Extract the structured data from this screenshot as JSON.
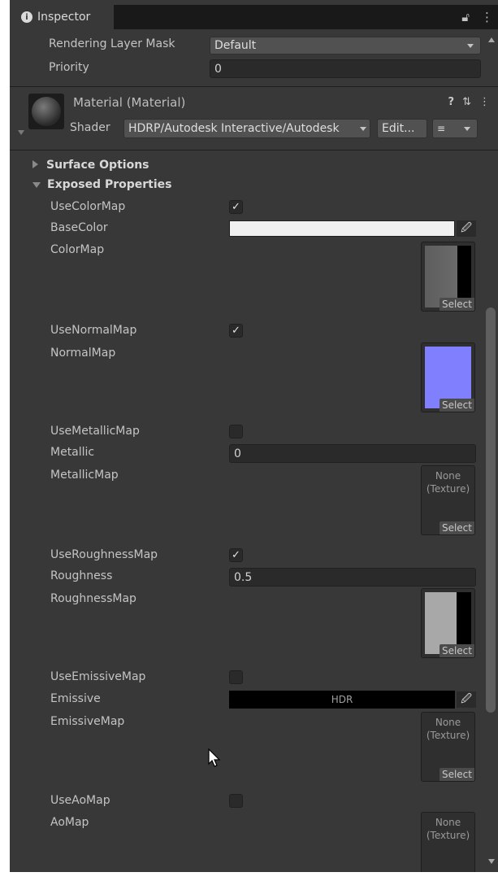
{
  "tab": {
    "title": "Inspector"
  },
  "rendering": {
    "layer_mask_label": "Rendering Layer Mask",
    "layer_mask_value": "Default",
    "priority_label": "Priority",
    "priority_value": "0"
  },
  "material": {
    "title": "Material (Material)",
    "shader_label": "Shader",
    "shader_value": "HDRP/Autodesk Interactive/Autodesk",
    "edit_label": "Edit...",
    "help_icon": "?"
  },
  "sections": {
    "surface_options": "Surface Options",
    "exposed_properties": "Exposed Properties"
  },
  "properties": {
    "use_color_map": {
      "label": "UseColorMap",
      "checked": true
    },
    "base_color": {
      "label": "BaseColor",
      "color": "#f0f0f0"
    },
    "color_map": {
      "label": "ColorMap",
      "select": "Select"
    },
    "use_normal_map": {
      "label": "UseNormalMap",
      "checked": true
    },
    "normal_map": {
      "label": "NormalMap",
      "select": "Select",
      "color": "#8080ff"
    },
    "use_metallic_map": {
      "label": "UseMetallicMap",
      "checked": false
    },
    "metallic": {
      "label": "Metallic",
      "value": "0"
    },
    "metallic_map": {
      "label": "MetallicMap",
      "none": "None",
      "none2": "(Texture)",
      "select": "Select"
    },
    "use_roughness_map": {
      "label": "UseRoughnessMap",
      "checked": true
    },
    "roughness": {
      "label": "Roughness",
      "value": "0.5"
    },
    "roughness_map": {
      "label": "RoughnessMap",
      "select": "Select"
    },
    "use_emissive_map": {
      "label": "UseEmissiveMap",
      "checked": false
    },
    "emissive": {
      "label": "Emissive",
      "hdr": "HDR",
      "color": "#000000"
    },
    "emissive_map": {
      "label": "EmissiveMap",
      "none": "None",
      "none2": "(Texture)",
      "select": "Select"
    },
    "use_ao_map": {
      "label": "UseAoMap",
      "checked": false
    },
    "ao_map": {
      "label": "AoMap",
      "none": "None",
      "none2": "(Texture)"
    }
  },
  "glyphs": {
    "check": "✓",
    "eyedropper": "⁄"
  },
  "colors": {
    "panel_bg": "#383838",
    "field_bg": "#2a2a2a",
    "accent_normal": "#8080ff"
  }
}
